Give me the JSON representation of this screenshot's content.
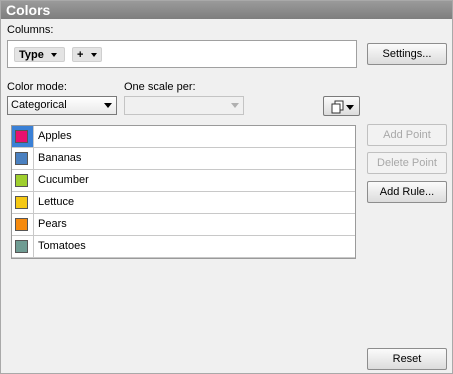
{
  "panel": {
    "title": "Colors"
  },
  "columns": {
    "label": "Columns:",
    "chips": [
      {
        "label": "Type"
      },
      {
        "label": "+"
      }
    ]
  },
  "buttons": {
    "settings": "Settings...",
    "add_point": "Add Point",
    "delete_point": "Delete Point",
    "add_rule": "Add Rule...",
    "reset": "Reset"
  },
  "color_mode": {
    "label": "Color mode:",
    "value": "Categorical"
  },
  "scale": {
    "label": "One scale per:",
    "value": ""
  },
  "categories": [
    {
      "name": "Apples",
      "color": "#e8106e",
      "selected": true
    },
    {
      "name": "Bananas",
      "color": "#4a80c0"
    },
    {
      "name": "Cucumber",
      "color": "#9fcf2e"
    },
    {
      "name": "Lettuce",
      "color": "#f5c814"
    },
    {
      "name": "Pears",
      "color": "#f58a0e"
    },
    {
      "name": "Tomatoes",
      "color": "#6f9c93"
    }
  ]
}
